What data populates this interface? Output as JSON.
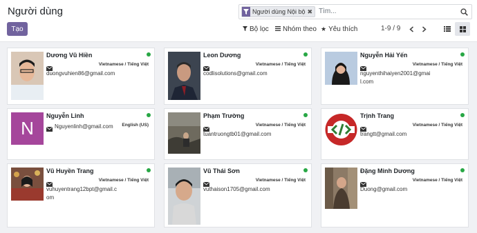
{
  "header": {
    "title": "Người dùng",
    "new_button": "Tạo"
  },
  "search": {
    "facet_label": "Người dùng Nội bộ",
    "placeholder": "Tìm..."
  },
  "toolbar": {
    "filters": "Bộ lọc",
    "group_by": "Nhóm theo",
    "favorites": "Yêu thích"
  },
  "pager": {
    "text": "1-9 / 9"
  },
  "colors": {
    "primary": "#71639e",
    "online": "#28a745"
  },
  "cards": [
    {
      "name": "Dương Vũ Hiền",
      "email": "duongvuhien86@gmail.com",
      "lang": "Vietnamese / Tiếng Việt"
    },
    {
      "name": "Leon Dương",
      "email": "codlisolutions@gmail.com",
      "lang": "Vietnamese / Tiếng Việt"
    },
    {
      "name": "Nguyễn Hải Yến",
      "email": "nguyenthihaiyen2001@gmail.com",
      "lang": "Vietnamese / Tiếng Việt"
    },
    {
      "name": "Nguyễn Linh",
      "email": "Nguyenlinh@gmail.com",
      "lang": "English (US)",
      "initial": "N"
    },
    {
      "name": "Phạm Trường",
      "email": "tuantruongtb01@gmail.com",
      "lang": "Vietnamese / Tiếng Việt"
    },
    {
      "name": "Trịnh Trang",
      "email": "trangtt@gmail.com",
      "lang": "Vietnamese / Tiếng Việt"
    },
    {
      "name": "Vũ Huyền Trang",
      "email": "vuhuyentrang12bpt@gmail.com",
      "lang": "Vietnamese / Tiếng Việt"
    },
    {
      "name": "Vũ Thái Sơn",
      "email": "vuthaison1705@gmail.com",
      "lang": "Vietnamese / Tiếng Việt"
    },
    {
      "name": "Đặng Minh Dương",
      "email": "Duong@gmail.com",
      "lang": "Vietnamese / Tiếng Việt"
    }
  ]
}
